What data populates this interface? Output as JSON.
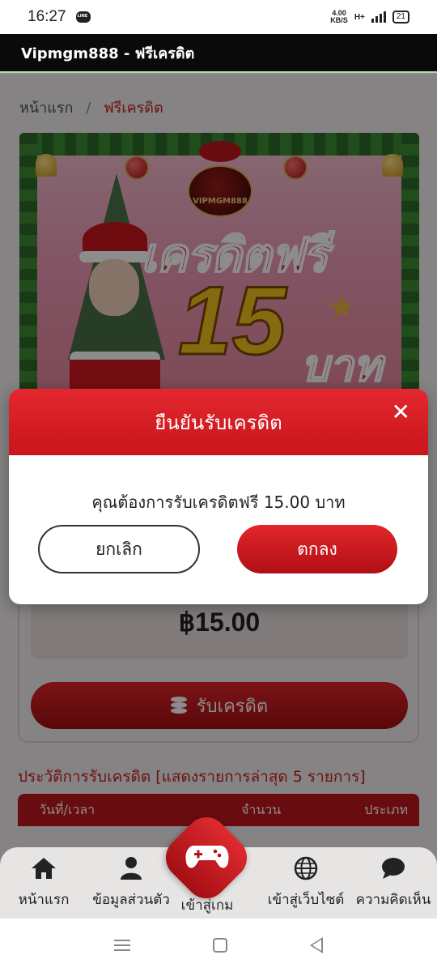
{
  "status_bar": {
    "time": "16:27",
    "net_speed": "4.00",
    "net_unit": "KB/S",
    "network_type": "H+",
    "battery": "21"
  },
  "title_bar": {
    "title": "Vipmgm888 - ฟรีเครดิต"
  },
  "breadcrumb": {
    "home": "หน้าแรก",
    "separator": "/",
    "current": "ฟรีเครดิต"
  },
  "banner": {
    "logo_text": "VIPMGM888",
    "headline": "เครดิตฟรี",
    "amount": "15",
    "unit": "บาท"
  },
  "credit_card": {
    "amount": "฿15.00",
    "receive_label": "รับเครดิต"
  },
  "history": {
    "title": "ประวัติการรับเครดิต [แสดงรายการล่าสุด 5 รายการ]",
    "columns": [
      "วันที่/เวลา",
      "จำนวน",
      "ประเภท"
    ]
  },
  "modal": {
    "title": "ยืนยันรับเครดิต",
    "close_symbol": "✕",
    "message": "คุณต้องการรับเครดิตฟรี 15.00 บาท",
    "cancel_label": "ยกเลิก",
    "ok_label": "ตกลง"
  },
  "bottom_nav": {
    "items": [
      {
        "label": "หน้าแรก",
        "icon": "home-icon"
      },
      {
        "label": "ข้อมูลส่วนตัว",
        "icon": "user-icon"
      },
      {
        "label": "เข้าสู่เกม",
        "icon": "gamepad-icon"
      },
      {
        "label": "เข้าสู่เว็บไซต์",
        "icon": "globe-icon"
      },
      {
        "label": "ความคิดเห็น",
        "icon": "chat-icon"
      }
    ]
  },
  "colors": {
    "brand_red": "#c81e22",
    "modal_header": "#d7191f",
    "title_bar_bg": "#0a0a0a"
  }
}
